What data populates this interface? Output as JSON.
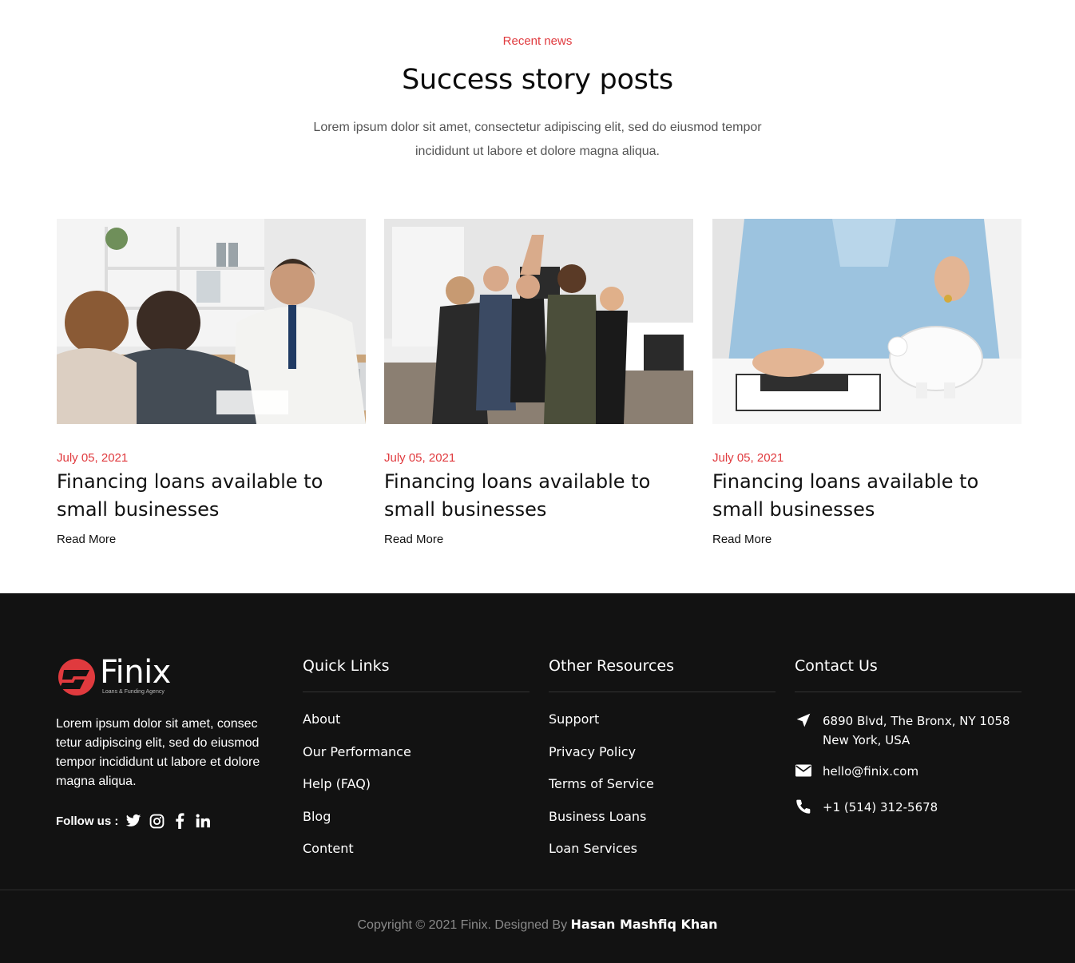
{
  "news": {
    "eyebrow": "Recent news",
    "title": "Success story posts",
    "subtitle": "Lorem ipsum dolor sit amet, consectetur adipiscing elit, sed do eiusmod tempor incididunt ut labore et dolore magna aliqua.",
    "posts": [
      {
        "date": "July 05, 2021",
        "title": "Financing loans available to small businesses",
        "link": "Read More"
      },
      {
        "date": "July 05, 2021",
        "title": "Financing loans available to small businesses",
        "link": "Read More"
      },
      {
        "date": "July 05, 2021",
        "title": "Financing loans available to small businesses",
        "link": "Read More"
      }
    ]
  },
  "footer": {
    "brand": {
      "name": "Finix",
      "tagline": "Loans & Funding Agency"
    },
    "about": "Lorem ipsum dolor sit amet, consec tetur adipiscing elit, sed do eiusmod tempor incididunt ut labore et dolore magna aliqua.",
    "follow_label": "Follow us :",
    "quick_links": {
      "title": "Quick Links",
      "items": [
        "About",
        "Our Performance",
        "Help (FAQ)",
        "Blog",
        "Content"
      ]
    },
    "other_resources": {
      "title": "Other Resources",
      "items": [
        "Support",
        "Privacy Policy",
        "Terms of Service",
        "Business Loans",
        "Loan Services"
      ]
    },
    "contact": {
      "title": "Contact Us",
      "address_line1": "6890 Blvd, The Bronx, NY 1058",
      "address_line2": "New York, USA",
      "email": "hello@finix.com",
      "phone": "+1 (514) 312-5678"
    },
    "copyright_prefix": "Copyright © 2021 Finix. Designed By",
    "designer": "Hasan Mashfiq Khan"
  },
  "colors": {
    "accent": "#e03a3e",
    "footer_bg": "#121212"
  }
}
